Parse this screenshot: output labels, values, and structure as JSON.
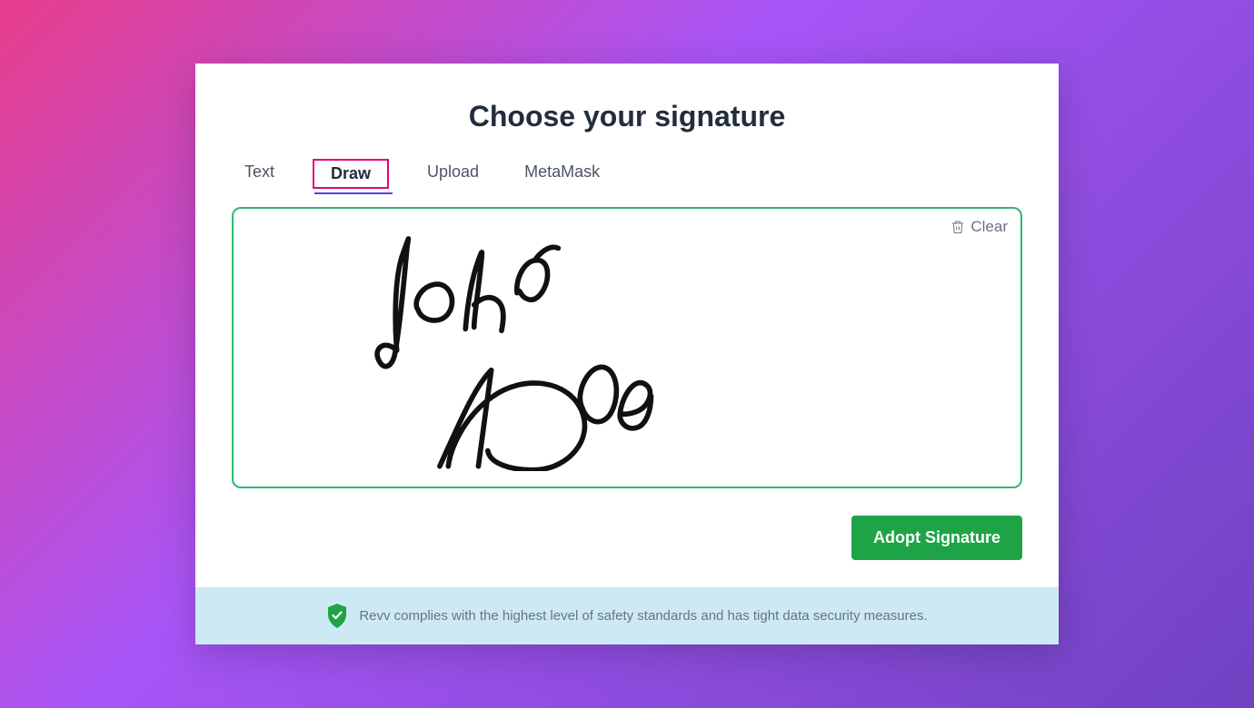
{
  "title": "Choose your signature",
  "tabs": [
    {
      "label": "Text",
      "active": false
    },
    {
      "label": "Draw",
      "active": true
    },
    {
      "label": "Upload",
      "active": false
    },
    {
      "label": "MetaMask",
      "active": false
    }
  ],
  "clear_label": "Clear",
  "adopt_label": "Adopt Signature",
  "footer_text": "Revv complies with the highest level of safety standards and has tight data security measures.",
  "signature_drawn_text": "John Doe"
}
